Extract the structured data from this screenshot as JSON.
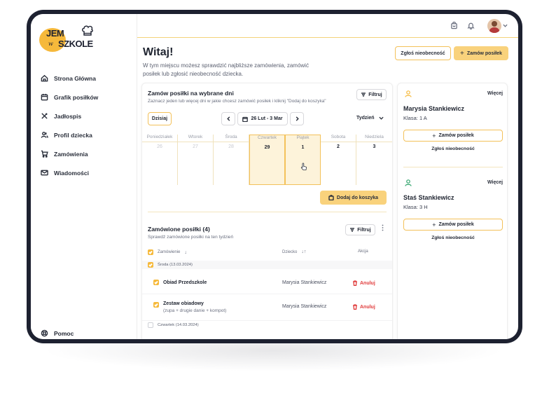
{
  "brand": {
    "word1": "JEM",
    "word2": "w",
    "word3": "SZKOLE"
  },
  "sidebar": {
    "items": [
      {
        "label": "Strona Główna",
        "icon": "home-icon"
      },
      {
        "label": "Grafik posiłków",
        "icon": "calendar-icon"
      },
      {
        "label": "Jadłospis",
        "icon": "cutlery-icon"
      },
      {
        "label": "Profil dziecka",
        "icon": "users-icon"
      },
      {
        "label": "Zamówienia",
        "icon": "cart-icon"
      },
      {
        "label": "Wiadomości",
        "icon": "mail-icon"
      }
    ],
    "help_label": "Pomoc"
  },
  "header": {
    "title": "Witaj!",
    "subtitle": "W tym miejscu możesz sprawdzić najbliższe zamówienia, zamówić posiłek lub zgłosić nieobecność dziecka.",
    "report_absence_label": "Zgłoś nieobecność",
    "order_meal_label": "Zamów posiłek"
  },
  "calendar_card": {
    "title": "Zamów posiłki na wybrane dni",
    "subtitle": "Zaznacz jeden lub więcej dni w jakie chcesz zamówić posiłek i kliknij \"Dodaj do koszyka\"",
    "filter_label": "Filtruj",
    "today_label": "Dzisiaj",
    "range_label": "26 Lut - 3 Mar",
    "view_label": "Tydzień",
    "days": [
      {
        "name": "Poniedziałek",
        "num": "26",
        "state": "dim"
      },
      {
        "name": "Wtorek",
        "num": "27",
        "state": "dim"
      },
      {
        "name": "Środa",
        "num": "28",
        "state": "dim"
      },
      {
        "name": "Czwartek",
        "num": "29",
        "state": "selected"
      },
      {
        "name": "Piątek",
        "num": "1",
        "state": "selected"
      },
      {
        "name": "Sobota",
        "num": "2",
        "state": "normal"
      },
      {
        "name": "Niedziela",
        "num": "3",
        "state": "normal"
      }
    ],
    "add_to_cart_label": "Dodaj do koszyka"
  },
  "orders": {
    "title": "Zamówione posiłki (4)",
    "subtitle": "Sprawdź zamówione posiłki na ten tydzień",
    "filter_label": "Filtruj",
    "col_order": "Zamówienie",
    "col_child": "Dziecko",
    "col_action": "Akcja",
    "groups": [
      {
        "date": "Środa (13.03.2024)"
      },
      {
        "date": "Czwartek (14.03.2024)"
      }
    ],
    "rows": [
      {
        "meal": "Obiad Przedszkole",
        "detail": "",
        "child": "Marysia Stankiewicz",
        "action": "Anuluj"
      },
      {
        "meal": "Zestaw obiadowy",
        "detail": "(zupa + drugie danie + kompot)",
        "child": "Marysia Stankiewicz",
        "action": "Anuluj"
      }
    ]
  },
  "children": [
    {
      "name": "Marysia Stankiewicz",
      "class_label": "Klasa:",
      "class_value": "1 A",
      "more": "Więcej",
      "order": "Zamów posiłek",
      "absent": "Zgłoś nieobecność",
      "icon_color": "#f6b93b"
    },
    {
      "name": "Staś Stankiewicz",
      "class_label": "Klasa:",
      "class_value": "3 H",
      "more": "Więcej",
      "order": "Zamów posiłek",
      "absent": "Zgłoś nieobecność",
      "icon_color": "#2fa36b"
    }
  ],
  "colors": {
    "accent": "#f6b93b",
    "accent_soft": "#f9d27c",
    "danger": "#e03b3b",
    "frame": "#1d2130"
  }
}
